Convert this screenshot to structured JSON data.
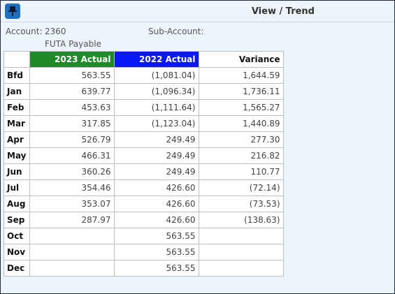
{
  "window": {
    "title": "View / Trend",
    "app_icon": "pin-icon"
  },
  "account": {
    "label": "Account:",
    "number": "2360",
    "name": "FUTA Payable"
  },
  "sub_account": {
    "label": "Sub-Account:",
    "value": ""
  },
  "colors": {
    "col_2023": "#1e8a2a",
    "col_2022": "#0a18f5"
  },
  "table": {
    "headers": [
      "",
      "2023 Actual",
      "2022 Actual",
      "Variance"
    ],
    "rows": [
      {
        "label": "Bfd",
        "a2023": "563.55",
        "a2022": "(1,081.04)",
        "variance": "1,644.59"
      },
      {
        "label": "Jan",
        "a2023": "639.77",
        "a2022": "(1,096.34)",
        "variance": "1,736.11"
      },
      {
        "label": "Feb",
        "a2023": "453.63",
        "a2022": "(1,111.64)",
        "variance": "1,565.27"
      },
      {
        "label": "Mar",
        "a2023": "317.85",
        "a2022": "(1,123.04)",
        "variance": "1,440.89"
      },
      {
        "label": "Apr",
        "a2023": "526.79",
        "a2022": "249.49",
        "variance": "277.30"
      },
      {
        "label": "May",
        "a2023": "466.31",
        "a2022": "249.49",
        "variance": "216.82"
      },
      {
        "label": "Jun",
        "a2023": "360.26",
        "a2022": "249.49",
        "variance": "110.77"
      },
      {
        "label": "Jul",
        "a2023": "354.46",
        "a2022": "426.60",
        "variance": "(72.14)"
      },
      {
        "label": "Aug",
        "a2023": "353.07",
        "a2022": "426.60",
        "variance": "(73.53)"
      },
      {
        "label": "Sep",
        "a2023": "287.97",
        "a2022": "426.60",
        "variance": "(138.63)"
      },
      {
        "label": "Oct",
        "a2023": "",
        "a2022": "563.55",
        "variance": ""
      },
      {
        "label": "Nov",
        "a2023": "",
        "a2022": "563.55",
        "variance": ""
      },
      {
        "label": "Dec",
        "a2023": "",
        "a2022": "563.55",
        "variance": ""
      }
    ]
  }
}
